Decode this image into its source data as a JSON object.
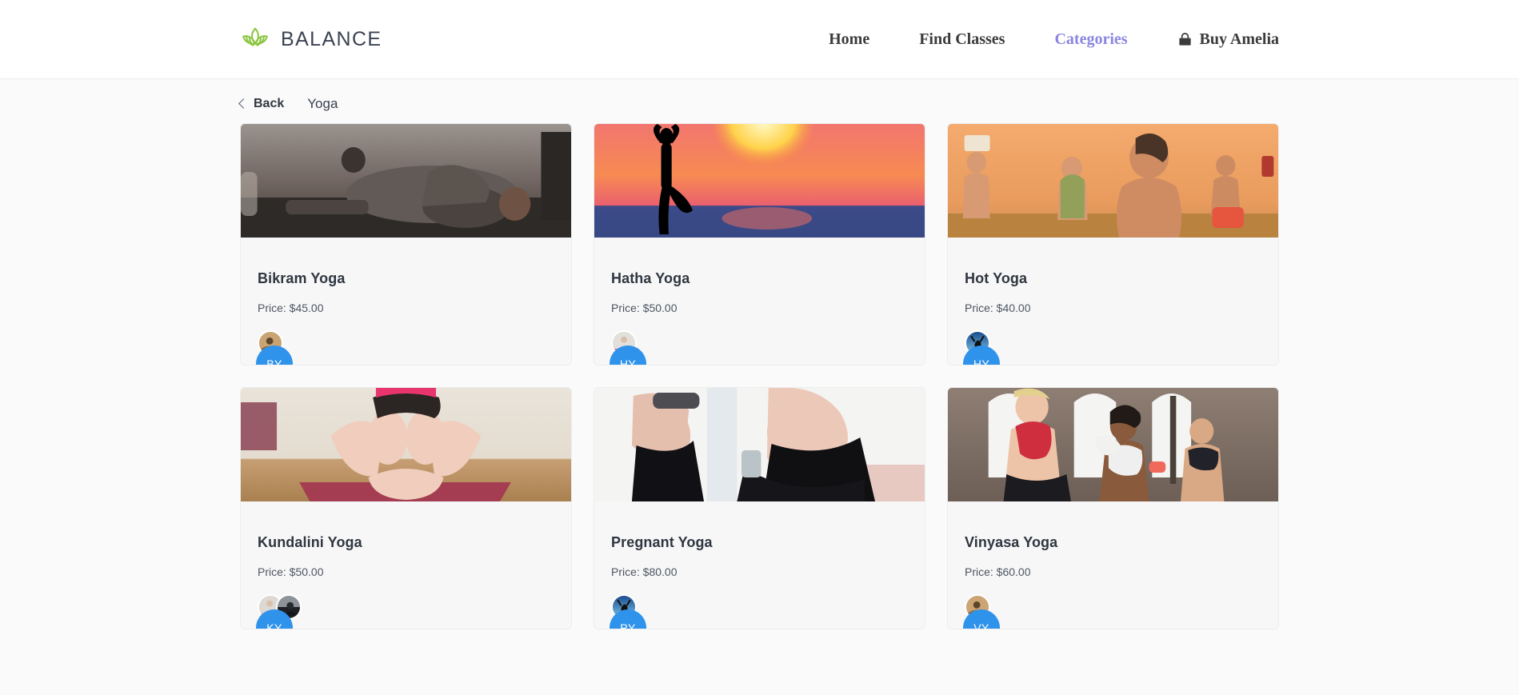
{
  "header": {
    "brand_name": "BALANCE",
    "logo_icon": "lotus-leaf-icon",
    "nav": [
      {
        "label": "Home",
        "active": false,
        "icon": null
      },
      {
        "label": "Find Classes",
        "active": false,
        "icon": null
      },
      {
        "label": "Categories",
        "active": true,
        "icon": null
      },
      {
        "label": "Buy Amelia",
        "active": false,
        "icon": "shopping-bag-icon"
      }
    ]
  },
  "breadcrumb": {
    "back_label": "Back",
    "back_icon": "chevron-left-icon",
    "current": "Yoga"
  },
  "colors": {
    "accent_badge": "#2f93ec",
    "nav_active": "#8a86e0",
    "brand_green": "#8bc53f",
    "page_background": "#fafafa",
    "card_background": "#f7f7f8",
    "card_border": "#eceded",
    "text_primary": "#2f3640",
    "text_secondary": "#4e5661"
  },
  "cards": [
    {
      "initials": "BY",
      "title": "Bikram Yoga",
      "price": "Price: $45.00",
      "image_alt": "woman-stretching-on-mat-in-gym",
      "avatars": 1
    },
    {
      "initials": "HY",
      "title": "Hatha Yoga",
      "price": "Price: $50.00",
      "image_alt": "tree-pose-silhouette-at-sunset-over-ocean",
      "avatars": 1
    },
    {
      "initials": "HY",
      "title": "Hot Yoga",
      "price": "Price: $40.00",
      "image_alt": "hot-yoga-class-in-orange-studio",
      "avatars": 1
    },
    {
      "initials": "KY",
      "title": "Kundalini Yoga",
      "price": "Price: $50.00",
      "image_alt": "forward-fold-feet-close-up-on-red-mat",
      "avatars": 2
    },
    {
      "initials": "PY",
      "title": "Pregnant Yoga",
      "price": "Price: $80.00",
      "image_alt": "two-pregnant-women-in-black-leggings",
      "avatars": 1
    },
    {
      "initials": "VY",
      "title": "Vinyasa Yoga",
      "price": "Price: $60.00",
      "image_alt": "three-women-stretching-in-brick-studio",
      "avatars": 1
    }
  ]
}
